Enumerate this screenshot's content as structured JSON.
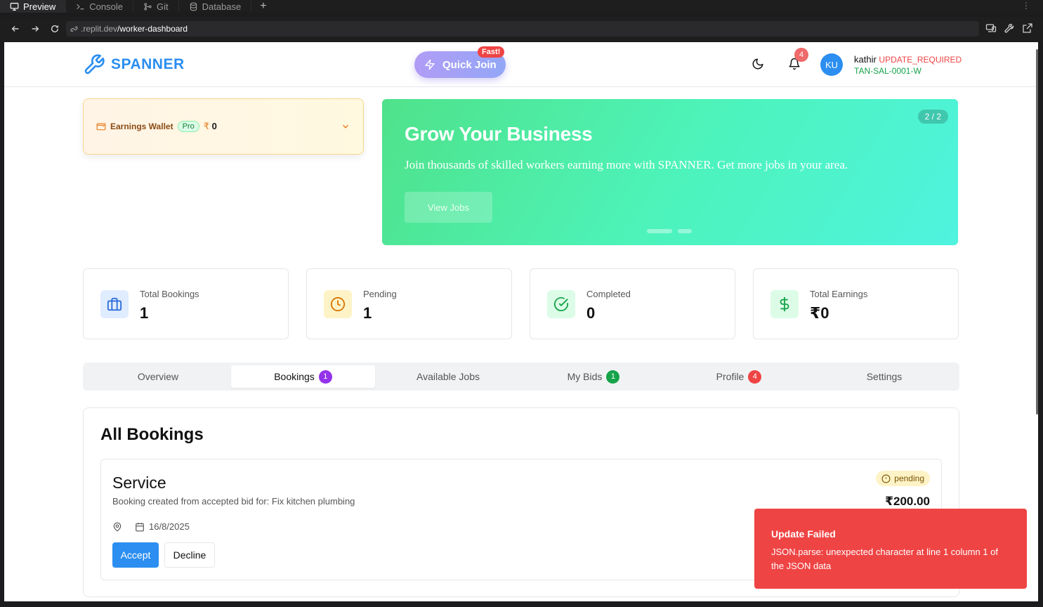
{
  "ide": {
    "tabs": [
      {
        "label": "Preview",
        "icon": "monitor-icon"
      },
      {
        "label": "Console",
        "icon": "terminal-icon"
      },
      {
        "label": "Git",
        "icon": "git-icon"
      },
      {
        "label": "Database",
        "icon": "database-icon"
      }
    ],
    "add_tab": "+",
    "menu": "⋮"
  },
  "browser": {
    "url_prefix": ".replit.dev",
    "url_path": "/worker-dashboard"
  },
  "header": {
    "brand": "SPANNER",
    "quick_join": "Quick Join",
    "fast_badge": "Fast!",
    "notification_count": "4",
    "avatar_initials": "KU",
    "user_name": "kathir",
    "user_status": "UPDATE_REQUIRED",
    "user_id": "TAN-SAL-0001-W"
  },
  "wallet": {
    "label": "Earnings Wallet",
    "badge": "Pro",
    "currency": "₹",
    "amount": "0"
  },
  "banner": {
    "title": "Grow Your Business",
    "subtitle": "Join thousands of skilled workers earning more with SPANNER. Get more jobs in your area.",
    "button": "View Jobs",
    "counter": "2 / 2",
    "slides": 2,
    "active_slide": 2
  },
  "stats": [
    {
      "label": "Total Bookings",
      "value": "1",
      "icon": "briefcase-icon",
      "color": "#2b6cd8",
      "bg": "#e0ecff"
    },
    {
      "label": "Pending",
      "value": "1",
      "icon": "clock-icon",
      "color": "#d97706",
      "bg": "#fef3c7"
    },
    {
      "label": "Completed",
      "value": "0",
      "icon": "check-circle-icon",
      "color": "#16a34a",
      "bg": "#dcfce7"
    },
    {
      "label": "Total Earnings",
      "value": "₹0",
      "icon": "dollar-icon",
      "color": "#16a34a",
      "bg": "#dcfce7"
    }
  ],
  "tabs": [
    {
      "label": "Overview",
      "badge": null
    },
    {
      "label": "Bookings",
      "badge": "1",
      "badge_color": "#9333ea",
      "active": true
    },
    {
      "label": "Available Jobs",
      "badge": null
    },
    {
      "label": "My Bids",
      "badge": "1",
      "badge_color": "#16a34a"
    },
    {
      "label": "Profile",
      "badge": "4",
      "badge_color": "#ef4444"
    },
    {
      "label": "Settings",
      "badge": null
    }
  ],
  "bookings": {
    "title": "All Bookings",
    "items": [
      {
        "title": "Service",
        "description": "Booking created from accepted bid for: Fix kitchen plumbing",
        "date": "16/8/2025",
        "status": "pending",
        "price": "₹200.00",
        "accept_label": "Accept",
        "decline_label": "Decline"
      }
    ]
  },
  "toast": {
    "title": "Update Failed",
    "message": "JSON.parse: unexpected character at line 1 column 1 of the JSON data"
  },
  "colors": {
    "brand": "#2b8ef0",
    "error": "#ef4444"
  }
}
